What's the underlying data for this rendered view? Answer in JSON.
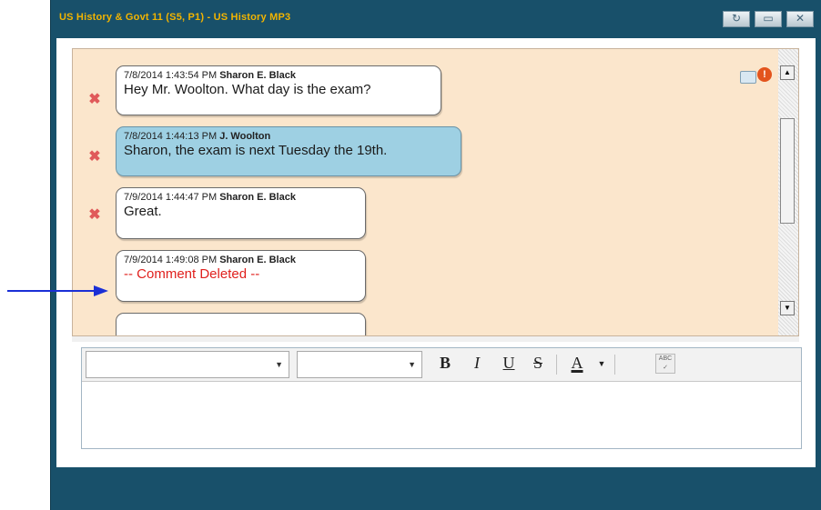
{
  "window": {
    "title": "US History & Govt 11 (S5, P1) - US History MP3",
    "buttons": [
      "refresh",
      "maximize",
      "close"
    ]
  },
  "messages": [
    {
      "datetime": "7/8/2014 1:43:54 PM",
      "author": "Sharon E. Black",
      "text": "Hey Mr. Woolton. What day is the exam?",
      "deletable": true,
      "style": "white"
    },
    {
      "datetime": "7/8/2014 1:44:13 PM",
      "author": "J. Woolton",
      "text": "Sharon, the exam is next Tuesday the 19th.",
      "deletable": true,
      "style": "blue"
    },
    {
      "datetime": "7/9/2014 1:44:47 PM",
      "author": "Sharon E. Black",
      "text": "Great.",
      "deletable": true,
      "style": "white"
    },
    {
      "datetime": "7/9/2014 1:49:08 PM",
      "author": "Sharon E. Black",
      "text": "-- Comment Deleted --",
      "deletable": false,
      "style": "white-deleted"
    }
  ],
  "chat_icons": [
    "folder-icon",
    "alert-icon"
  ],
  "editor": {
    "font_family_value": "",
    "font_size_value": "",
    "tools": [
      "B",
      "I",
      "U",
      "S",
      "A"
    ],
    "spellcheck_label": "ABC"
  },
  "colors": {
    "window_frame": "#18506a",
    "title_text": "#f2b400",
    "chat_background": "#fbe6cc",
    "tutor_bubble": "#9ed0e3",
    "deleted_text": "#e0201d",
    "pointer_arrow": "#1a2fd6"
  }
}
